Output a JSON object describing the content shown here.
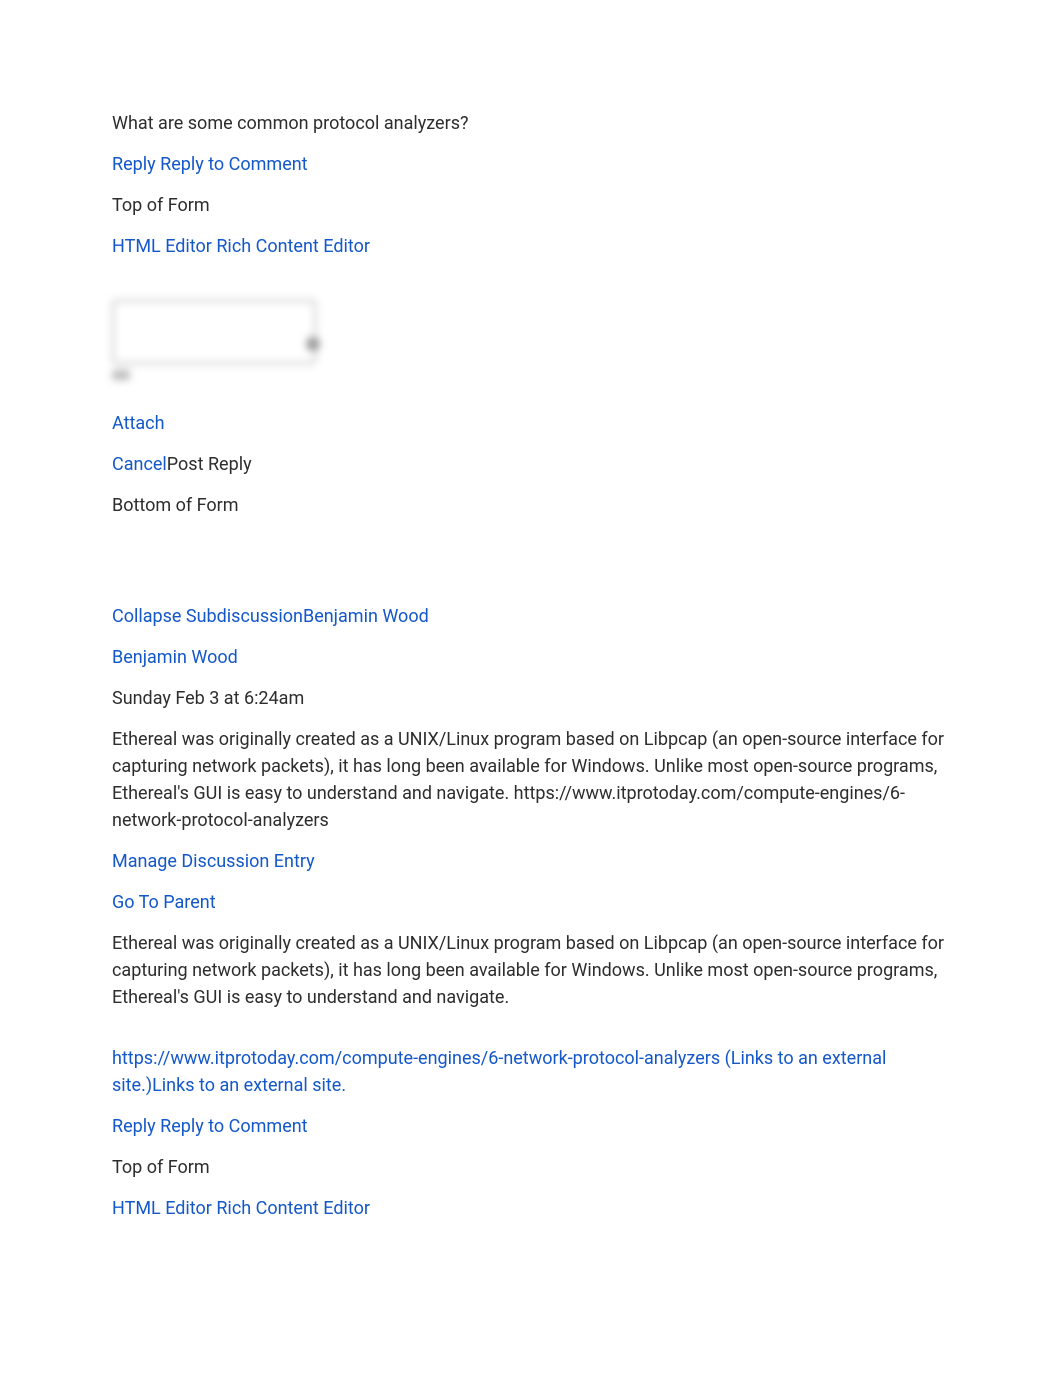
{
  "comment1": {
    "question": "What are some common protocol analyzers?",
    "reply_label": "Reply Reply to Comment",
    "top_of_form": "Top of Form",
    "html_editor": "HTML Editor",
    "rich_editor": "Rich Content Editor",
    "attach": "Attach",
    "cancel": "Cancel",
    "post_reply": "Post Reply",
    "bottom_of_form": "Bottom of Form"
  },
  "comment2": {
    "collapse": "Collapse Subdiscussion",
    "author": "Benjamin Wood",
    "author_link": "Benjamin Wood",
    "timestamp": "Sunday Feb 3 at 6:24am",
    "body1": "Ethereal was originally created as a UNIX/Linux program based on Libpcap (an open-source interface for capturing network packets), it has long been available for Windows. Unlike most open-source programs, Ethereal's GUI is easy to understand and navigate. https://www.itprotoday.com/compute-engines/6-network-protocol-analyzers",
    "manage": "Manage Discussion Entry",
    "go_parent": "Go To Parent",
    "body2": "Ethereal was originally created as a UNIX/Linux program based on Libpcap (an open-source interface for capturing network packets), it has long been available for Windows. Unlike most open-source programs, Ethereal's GUI is easy to understand and navigate.",
    "ext_link": "https://www.itprotoday.com/compute-engines/6-network-protocol-analyzers (Links to an external site.)Links to an external site.",
    "reply_label": "Reply Reply to Comment",
    "top_of_form": "Top of Form",
    "html_editor": "HTML Editor",
    "rich_editor": "Rich Content Editor"
  }
}
